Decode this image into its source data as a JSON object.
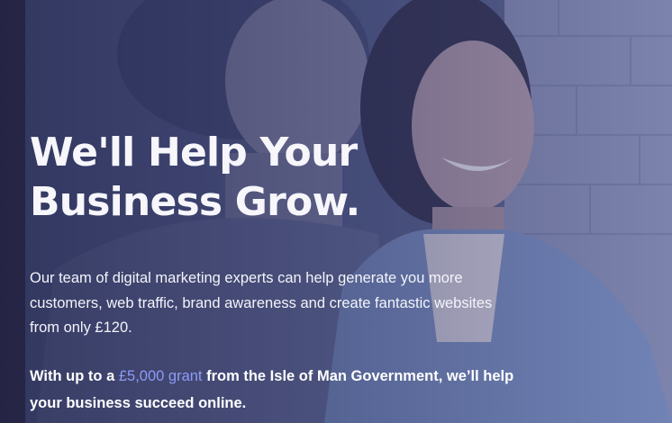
{
  "hero": {
    "headline_line1": "We'll Help Your",
    "headline_line2": "Business Grow.",
    "body": "Our team of digital marketing experts can help generate you more customers, web traffic, brand awareness and create fantastic websites from only £120.",
    "grant_prefix": "With up to a ",
    "grant_link": "£5,000 grant",
    "grant_suffix": " from the Isle of Man Government, we’ll help your business succeed online."
  },
  "colors": {
    "overlay": "#2a3160",
    "link_accent": "#8f9af5",
    "text": "#ffffff"
  }
}
